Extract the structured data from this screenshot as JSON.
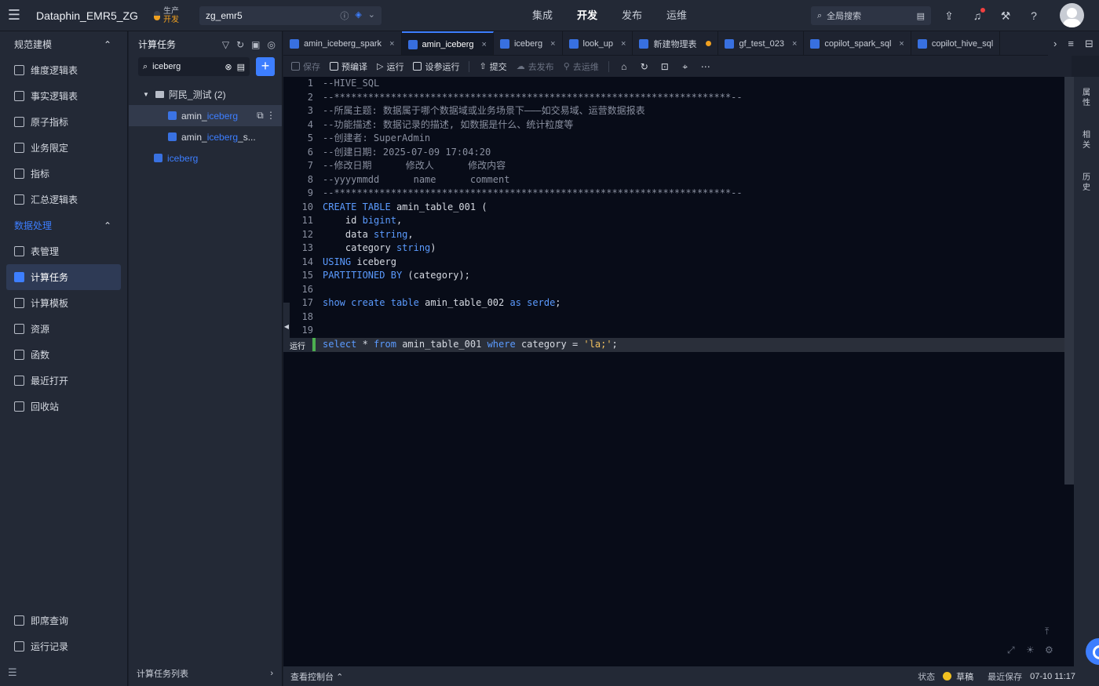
{
  "header": {
    "app_title": "Dataphin_EMR5_ZG",
    "env_prod": "生产",
    "env_dev": "开发",
    "project": "zg_emr5",
    "nav": [
      "集成",
      "开发",
      "发布",
      "运维"
    ],
    "nav_active": "开发",
    "search_placeholder": "全局搜索"
  },
  "sidebar": {
    "section1": "规范建模",
    "items1": [
      "维度逻辑表",
      "事实逻辑表",
      "原子指标",
      "业务限定",
      "指标",
      "汇总逻辑表"
    ],
    "section2": "数据处理",
    "items2": [
      "表管理",
      "计算任务",
      "计算模板",
      "资源",
      "函数",
      "最近打开",
      "回收站"
    ],
    "active": "计算任务",
    "bottom_items": [
      "即席查询",
      "运行记录"
    ]
  },
  "tree_panel": {
    "title": "计算任务",
    "search_value": "iceberg",
    "folder": "阿民_测试 (2)",
    "children": [
      {
        "prefix": "amin_",
        "match": "iceberg",
        "suffix": ""
      },
      {
        "prefix": "amin_",
        "match": "iceberg",
        "suffix": "_s..."
      }
    ],
    "other": "iceberg",
    "footer": "计算任务列表"
  },
  "tabs": [
    {
      "label": "amin_iceberg_spark",
      "active": false,
      "close": "×"
    },
    {
      "label": "amin_iceberg",
      "active": true,
      "close": "×"
    },
    {
      "label": "iceberg",
      "active": false,
      "close": "×"
    },
    {
      "label": "look_up",
      "active": false,
      "close": "×"
    },
    {
      "label": "新建物理表",
      "active": false,
      "dot": true
    },
    {
      "label": "gf_test_023",
      "active": false,
      "close": "×"
    },
    {
      "label": "copilot_spark_sql",
      "active": false,
      "close": "×"
    },
    {
      "label": "copilot_hive_sql",
      "active": false,
      "close": ""
    }
  ],
  "toolbar": {
    "save": "保存",
    "precompile": "预编译",
    "run": "运行",
    "param_run": "设参运行",
    "submit": "提交",
    "publish": "去发布",
    "ops": "去运维"
  },
  "editor": {
    "run_label": "运行",
    "lines": [
      "--HIVE_SQL",
      "--**********************************************************************--",
      "--所属主题: 数据属于哪个数据域或业务场景下———如交易域、运营数据报表",
      "--功能描述: 数据记录的描述, 如数据是什么、统计粒度等",
      "--创建者: SuperAdmin",
      "--创建日期: 2025-07-09 17:04:20",
      "--修改日期      修改人      修改内容",
      "--yyyymmdd      name      comment",
      "--**********************************************************************--",
      "CREATE TABLE amin_table_001 (",
      "    id bigint,",
      "    data string,",
      "    category string)",
      "USING iceberg",
      "PARTITIONED BY (category);",
      "",
      "show create table amin_table_002 as serde;",
      "",
      "",
      "select * from amin_table_001 where category = 'la;';"
    ]
  },
  "right_rail": [
    "属性",
    "相关",
    "历史"
  ],
  "status": {
    "console": "查看控制台",
    "state_label": "状态",
    "state_value": "草稿",
    "last_save_label": "最近保存",
    "last_save_value": "07-10 11:17"
  }
}
